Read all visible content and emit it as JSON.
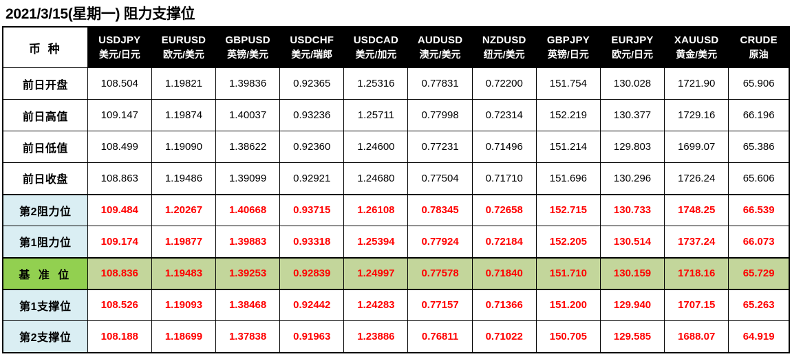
{
  "title": "2021/3/15(星期一) 阻力支撑位",
  "table": {
    "corner_header": "币 种",
    "columns": [
      {
        "code": "USDJPY",
        "cn": "美元/日元"
      },
      {
        "code": "EURUSD",
        "cn": "欧元/美元"
      },
      {
        "code": "GBPUSD",
        "cn": "英镑/美元"
      },
      {
        "code": "USDCHF",
        "cn": "美元/瑞郎"
      },
      {
        "code": "USDCAD",
        "cn": "美元/加元"
      },
      {
        "code": "AUDUSD",
        "cn": "澳元/美元"
      },
      {
        "code": "NZDUSD",
        "cn": "纽元/美元"
      },
      {
        "code": "GBPJPY",
        "cn": "英镑/日元"
      },
      {
        "code": "EURJPY",
        "cn": "欧元/日元"
      },
      {
        "code": "XAUUSD",
        "cn": "黄金/美元"
      },
      {
        "code": "CRUDE",
        "cn": "原油"
      }
    ],
    "rows": [
      {
        "label": "前日开盘",
        "style": "prior",
        "values": [
          "108.504",
          "1.19821",
          "1.39836",
          "0.92365",
          "1.25316",
          "0.77831",
          "0.72200",
          "151.754",
          "130.028",
          "1721.90",
          "65.906"
        ]
      },
      {
        "label": "前日高值",
        "style": "prior",
        "values": [
          "109.147",
          "1.19874",
          "1.40037",
          "0.93236",
          "1.25711",
          "0.77998",
          "0.72314",
          "152.219",
          "130.377",
          "1729.16",
          "66.196"
        ]
      },
      {
        "label": "前日低值",
        "style": "prior",
        "values": [
          "108.499",
          "1.19090",
          "1.38622",
          "0.92360",
          "1.24600",
          "0.77231",
          "0.71496",
          "151.214",
          "129.803",
          "1699.07",
          "65.386"
        ]
      },
      {
        "label": "前日收盘",
        "style": "prior",
        "values": [
          "108.863",
          "1.19486",
          "1.39099",
          "0.92921",
          "1.24680",
          "0.77504",
          "0.71710",
          "151.696",
          "130.296",
          "1726.24",
          "65.606"
        ]
      },
      {
        "label": "第2阻力位",
        "style": "level",
        "values": [
          "109.484",
          "1.20267",
          "1.40668",
          "0.93715",
          "1.26108",
          "0.78345",
          "0.72658",
          "152.715",
          "130.733",
          "1748.25",
          "66.539"
        ]
      },
      {
        "label": "第1阻力位",
        "style": "level",
        "values": [
          "109.174",
          "1.19877",
          "1.39883",
          "0.93318",
          "1.25394",
          "0.77924",
          "0.72184",
          "152.205",
          "130.514",
          "1737.24",
          "66.073"
        ]
      },
      {
        "label": "基 准 位",
        "style": "baseline",
        "values": [
          "108.836",
          "1.19483",
          "1.39253",
          "0.92839",
          "1.24997",
          "0.77578",
          "0.71840",
          "151.710",
          "130.159",
          "1718.16",
          "65.729"
        ]
      },
      {
        "label": "第1支撑位",
        "style": "level",
        "values": [
          "108.526",
          "1.19093",
          "1.38468",
          "0.92442",
          "1.24283",
          "0.77157",
          "0.71366",
          "151.200",
          "129.940",
          "1707.15",
          "65.263"
        ]
      },
      {
        "label": "第2支撑位",
        "style": "level",
        "values": [
          "108.188",
          "1.18699",
          "1.37838",
          "0.91963",
          "1.23886",
          "0.76811",
          "0.71022",
          "150.705",
          "129.585",
          "1688.07",
          "64.919"
        ]
      }
    ]
  },
  "colors": {
    "header_bg": "#000000",
    "header_text": "#FFFFFF",
    "level_value_text": "#FF0000",
    "level_label_bg": "#DAEEF3",
    "baseline_label_bg": "#92D050",
    "baseline_value_bg": "#C3D69B",
    "page_bg": "#FFFFFF",
    "grid_line": "#000000"
  }
}
